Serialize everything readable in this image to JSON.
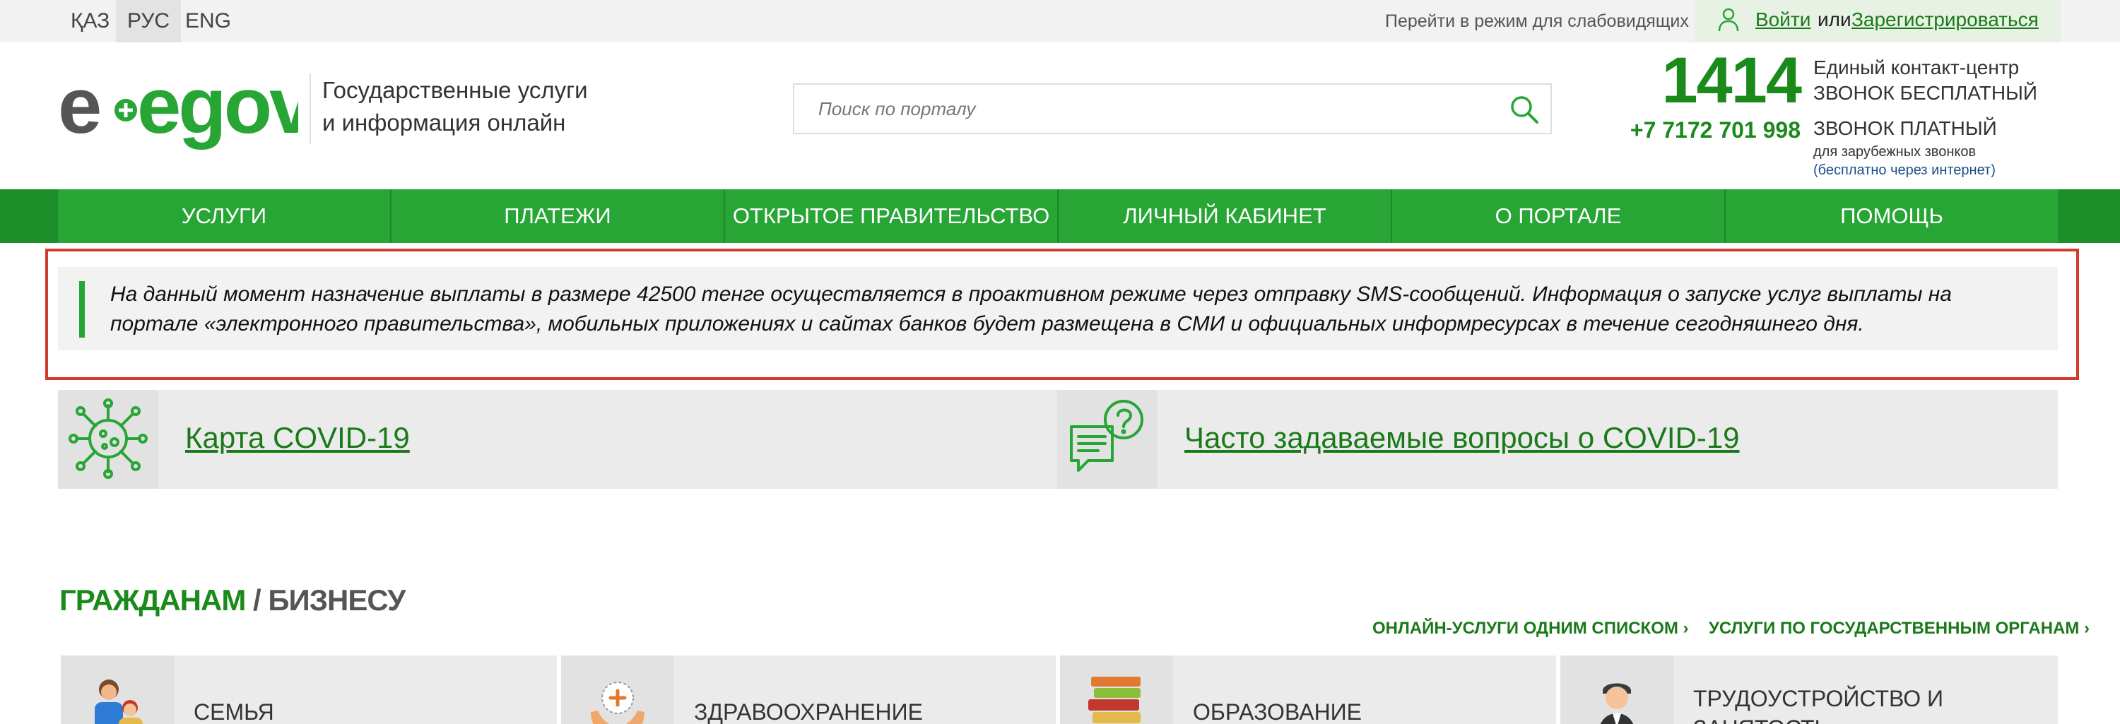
{
  "topbar": {
    "languages": [
      {
        "label": "ҚАЗ",
        "active": false
      },
      {
        "label": "РУС",
        "active": true
      },
      {
        "label": "ENG",
        "active": false
      }
    ],
    "vision_mode": "Перейти в режим для слабовидящих",
    "auth": {
      "login": "Войти",
      "or": "или",
      "register": "Зарегистрироваться"
    }
  },
  "header": {
    "logo_text": "egov",
    "tagline_line1": "Государственные услуги",
    "tagline_line2": "и информация онлайн",
    "search_placeholder": "Поиск по порталу",
    "contact": {
      "short_number": "1414",
      "contact_center": "Единый контакт-центр",
      "free_call": "ЗВОНОК БЕСПЛАТНЫЙ",
      "paid_number": "+7 7172 701 998",
      "paid_call": "ЗВОНОК ПЛАТНЫЙ",
      "foreign_note": "для зарубежных звонков",
      "internet_note": "(бесплатно через интернет)"
    }
  },
  "nav": {
    "items": [
      "УСЛУГИ",
      "ПЛАТЕЖИ",
      "ОТКРЫТОЕ ПРАВИТЕЛЬСТВО",
      "ЛИЧНЫЙ КАБИНЕТ",
      "О ПОРТАЛЕ",
      "ПОМОЩЬ"
    ]
  },
  "notice": {
    "text": "На данный момент назначение выплаты в размере 42500 тенге осуществляется в проактивном режиме через отправку SMS-сообщений. Информация о запуске услуг выплаты на портале «электронного правительства», мобильных приложениях и сайтах банков будет размещена в СМИ и официальных информресурсах в течение сегодняшнего дня."
  },
  "covid": {
    "map_link": "Карта COVID-19",
    "faq_link": "Часто задаваемые вопросы о COVID-19"
  },
  "sections": {
    "citizens": "ГРАЖДАНАМ",
    "separator": " / ",
    "business": "БИЗНЕСУ",
    "online_services": "ОНЛАЙН-УСЛУГИ ОДНИМ СПИСКОМ ›",
    "by_agency": "УСЛУГИ ПО ГОСУДАРСТВЕННЫМ ОРГАНАМ ›",
    "categories": [
      "СЕМЬЯ",
      "ЗДРАВООХРАНЕНИЕ",
      "ОБРАЗОВАНИЕ",
      "ТРУДОУСТРОЙСТВО И ЗАНЯТОСТЬ"
    ]
  },
  "colors": {
    "brand_green": "#27a535",
    "brand_green_dark": "#1a8a1a",
    "notice_border": "#d33a2c"
  },
  "icons": {
    "user": "user-icon",
    "search": "search-icon",
    "covid": "virus-icon",
    "faq": "chat-question-icon",
    "family": "family-icon",
    "health": "medical-hands-icon",
    "education": "books-icon",
    "employment": "worker-icon"
  }
}
